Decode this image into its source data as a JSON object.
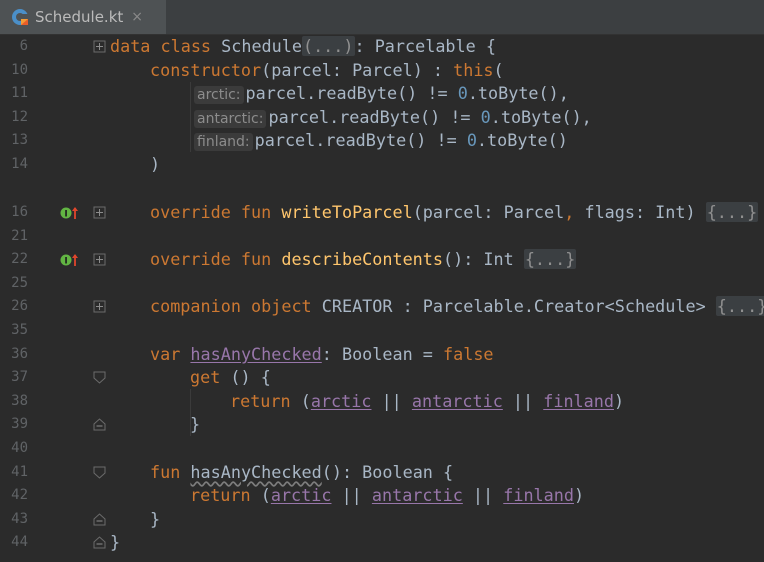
{
  "tab": {
    "file_name": "Schedule.kt",
    "close_glyph": "×"
  },
  "line_numbers": [
    "6",
    "10",
    "11",
    "12",
    "13",
    "14",
    "16",
    "21",
    "22",
    "25",
    "26",
    "35",
    "36",
    "37",
    "38",
    "39",
    "40",
    "41",
    "42",
    "43",
    "44"
  ],
  "hints": {
    "arctic": "arctic:",
    "antarctic": "antarctic:",
    "finland": "finland:"
  },
  "code": {
    "l6_kw": "data class ",
    "l6_name": "Schedule",
    "l6_fold": "(...)",
    "l6_rest": ": Parcelable {",
    "l10_kw": "constructor",
    "l10_mid": "(parcel: Parcel) : ",
    "l10_this": "this",
    "l10_end": "(",
    "l11_a": "parcel.readByte() != ",
    "l11_num": "0",
    "l11_b": ".toByte(),",
    "l12_a": "parcel.readByte() != ",
    "l12_num": "0",
    "l12_b": ".toByte(),",
    "l13_a": "parcel.readByte() != ",
    "l13_num": "0",
    "l13_b": ".toByte()",
    "l14": ")",
    "l16_kw": "override fun ",
    "l16_fn": "writeToParcel",
    "l16_mid": "(parcel: Parcel",
    "l16_comma": ",",
    "l16_rest": " flags: Int) ",
    "l16_fold": "{...}",
    "l22_kw": "override fun ",
    "l22_fn": "describeContents",
    "l22_rest": "(): Int ",
    "l22_fold": "{...}",
    "l26_kw": "companion object ",
    "l26_rest": "CREATOR : Parcelable.Creator<Schedule> ",
    "l26_fold": "{...}",
    "l36_kw": "var ",
    "l36_prop": "hasAnyChecked",
    "l36_mid": ": Boolean = ",
    "l36_false": "false",
    "l37_kw": "get",
    "l37_rest": " () {",
    "l38_kw": "return",
    "l38_a": " (",
    "l38_p1": "arctic",
    "l38_or1": " || ",
    "l38_p2": "antarctic",
    "l38_or2": " || ",
    "l38_p3": "finland",
    "l38_end": ")",
    "l39": "}",
    "l41_kw": "fun ",
    "l41_fn": "hasAnyChecked",
    "l41_rest": "(): Boolean {",
    "l42_kw": "return",
    "l42_a": " (",
    "l42_p1": "arctic",
    "l42_or1": " || ",
    "l42_p2": "antarctic",
    "l42_or2": " || ",
    "l42_p3": "finland",
    "l42_end": ")",
    "l43": "}",
    "l44": "}"
  },
  "icons": {
    "kotlin_file": "kotlin-file-icon",
    "implements": "implements-override-icon",
    "fold_expand": "fold-expand-icon",
    "fold_start": "fold-start-icon",
    "fold_end": "fold-end-icon"
  },
  "colors": {
    "background": "#2b2b2b",
    "keyword": "#cc7832",
    "function": "#ffc66d",
    "number": "#6897bb",
    "property": "#9876aa",
    "text": "#a9b7c6",
    "line_number": "#606366"
  }
}
